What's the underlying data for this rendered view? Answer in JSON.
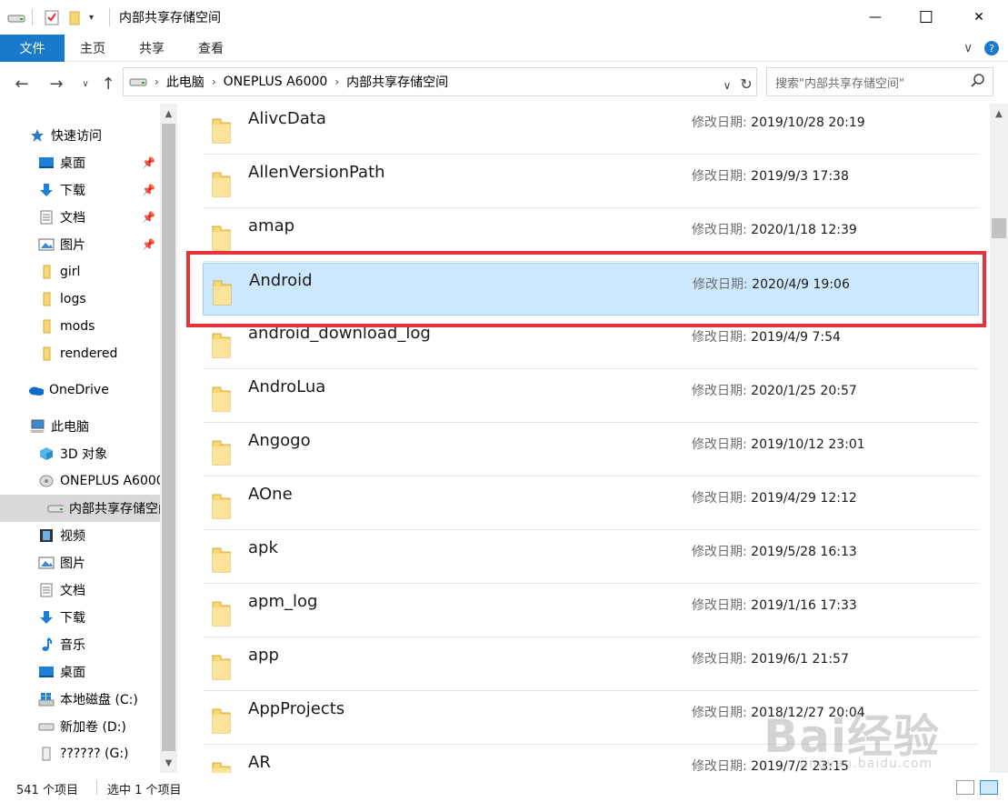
{
  "window": {
    "title": "内部共享存储空间",
    "minimize_glyph": "—",
    "maximize_glyph": "☐",
    "close_glyph": "✕"
  },
  "ribbon": {
    "tabs": [
      {
        "label": "文件",
        "active": true
      },
      {
        "label": "主页"
      },
      {
        "label": "共享"
      },
      {
        "label": "查看"
      }
    ]
  },
  "nav": {
    "breadcrumbs": [
      "此电脑",
      "ONEPLUS A6000",
      "内部共享存储空间"
    ],
    "search_placeholder": "搜索\"内部共享存储空间\""
  },
  "sidebar": {
    "items": [
      {
        "label": "快速访问",
        "icon": "star-icon",
        "level": 0
      },
      {
        "label": "桌面",
        "icon": "desktop-icon",
        "level": 1,
        "pinned": true
      },
      {
        "label": "下载",
        "icon": "download-icon",
        "level": 1,
        "pinned": true
      },
      {
        "label": "文档",
        "icon": "document-icon",
        "level": 1,
        "pinned": true
      },
      {
        "label": "图片",
        "icon": "picture-icon",
        "level": 1,
        "pinned": true
      },
      {
        "label": "girl",
        "icon": "folder-icon",
        "level": 1
      },
      {
        "label": "logs",
        "icon": "folder-icon",
        "level": 1
      },
      {
        "label": "mods",
        "icon": "folder-icon",
        "level": 1
      },
      {
        "label": "rendered",
        "icon": "folder-icon",
        "level": 1
      },
      {
        "label": "OneDrive",
        "icon": "cloud-icon",
        "level": 0
      },
      {
        "label": "此电脑",
        "icon": "computer-icon",
        "level": 0
      },
      {
        "label": "3D 对象",
        "icon": "cube-icon",
        "level": 1
      },
      {
        "label": "ONEPLUS A6000",
        "icon": "phone-drive-icon",
        "level": 1
      },
      {
        "label": "内部共享存储空间",
        "icon": "storage-icon",
        "level": 2,
        "selected": true
      },
      {
        "label": "视频",
        "icon": "video-icon",
        "level": 1
      },
      {
        "label": "图片",
        "icon": "picture-icon",
        "level": 1
      },
      {
        "label": "文档",
        "icon": "document-icon",
        "level": 1
      },
      {
        "label": "下载",
        "icon": "download-icon",
        "level": 1
      },
      {
        "label": "音乐",
        "icon": "music-icon",
        "level": 1
      },
      {
        "label": "桌面",
        "icon": "desktop-icon",
        "level": 1
      },
      {
        "label": "本地磁盘 (C:)",
        "icon": "windows-drive-icon",
        "level": 1
      },
      {
        "label": "新加卷 (D:)",
        "icon": "drive-icon",
        "level": 1
      },
      {
        "label": "?????? (G:)",
        "icon": "usb-drive-icon",
        "level": 1
      }
    ]
  },
  "files": {
    "date_label": "修改日期:",
    "rows": [
      {
        "name": "AlivcData",
        "date": "2019/10/28 20:19"
      },
      {
        "name": "AllenVersionPath",
        "date": "2019/9/3 17:38"
      },
      {
        "name": "amap",
        "date": "2020/1/18 12:39"
      },
      {
        "name": "Android",
        "date": "2020/4/9 19:06",
        "selected": true
      },
      {
        "name": "android_download_log",
        "date": "2019/4/9 7:54"
      },
      {
        "name": "AndroLua",
        "date": "2020/1/25 20:57"
      },
      {
        "name": "Angogo",
        "date": "2019/10/12 23:01"
      },
      {
        "name": "AOne",
        "date": "2019/4/29 12:12"
      },
      {
        "name": "apk",
        "date": "2019/5/28 16:13"
      },
      {
        "name": "apm_log",
        "date": "2019/1/16 17:33"
      },
      {
        "name": "app",
        "date": "2019/6/1 21:57"
      },
      {
        "name": "AppProjects",
        "date": "2018/12/27 20:04"
      },
      {
        "name": "AR",
        "date": "2019/7/2 23:15"
      }
    ]
  },
  "status": {
    "count": "541 个项目",
    "selection": "选中 1 个项目"
  },
  "watermark": {
    "main": "Bai经验",
    "sub": "jingyan.baidu.com"
  },
  "colors": {
    "accent": "#1979ca",
    "selection": "#cce8ff",
    "highlight": "#e8323c",
    "folder": "#f8d775"
  }
}
